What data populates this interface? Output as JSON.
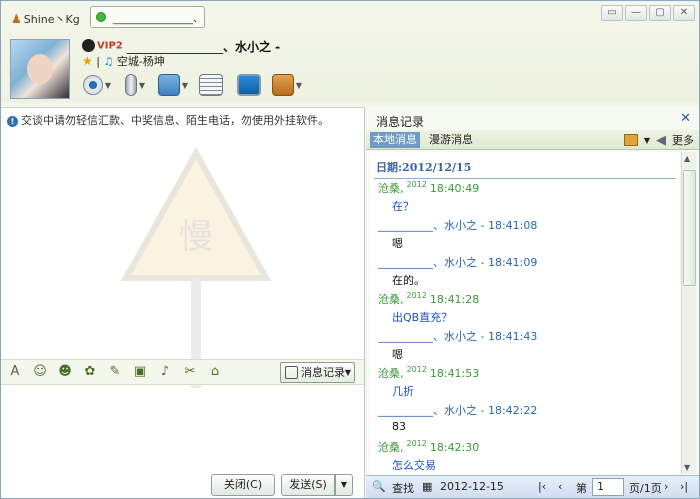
{
  "window": {
    "app_name": "Shine丶Kg",
    "status_text": "________________、",
    "buttons": [
      "▭",
      "—",
      "▢",
      "✕"
    ]
  },
  "header": {
    "vip_label": "VIP2",
    "contact_prefix": "________________",
    "contact_name": "、水小之 -",
    "music_text": "空城-杨坤"
  },
  "chat": {
    "notice": "交谈中请勿轻信汇款、中奖信息、陌生电话，勿使用外挂软件。",
    "history_button": "消息记录",
    "close_button": "关闭(C)",
    "send_button": "发送(S)"
  },
  "history": {
    "title": "消息记录",
    "tab_local": "本地消息",
    "tab_roam": "漫游消息",
    "more": "更多",
    "date_header": "日期:2012/12/15",
    "messages": [
      {
        "sender": "沧桑,",
        "tag": "2012",
        "time": "18:40:49",
        "text": "在？",
        "side": "self"
      },
      {
        "sender": "__________、水小之",
        "tag": "",
        "time": "- 18:41:08",
        "text": "嗯",
        "side": "peer"
      },
      {
        "sender": "__________、水小之",
        "tag": "",
        "time": "- 18:41:09",
        "text": "在的。",
        "side": "peer"
      },
      {
        "sender": "沧桑,",
        "tag": "2012",
        "time": "18:41:28",
        "text": "出QB直充？",
        "side": "self"
      },
      {
        "sender": "__________、水小之",
        "tag": "",
        "time": "- 18:41:43",
        "text": "嗯",
        "side": "peer"
      },
      {
        "sender": "沧桑,",
        "tag": "2012",
        "time": "18:41:53",
        "text": "几折",
        "side": "self"
      },
      {
        "sender": "__________、水小之",
        "tag": "",
        "time": "- 18:42:22",
        "text": "83",
        "side": "peer"
      },
      {
        "sender": "沧桑,",
        "tag": "2012",
        "time": "18:42:30",
        "text": "怎么交易",
        "side": "self"
      }
    ],
    "footer": {
      "search": "查找",
      "date": "2012-12-15",
      "page_prefix": "第",
      "page_value": "1",
      "page_suffix": "页/1页"
    }
  }
}
